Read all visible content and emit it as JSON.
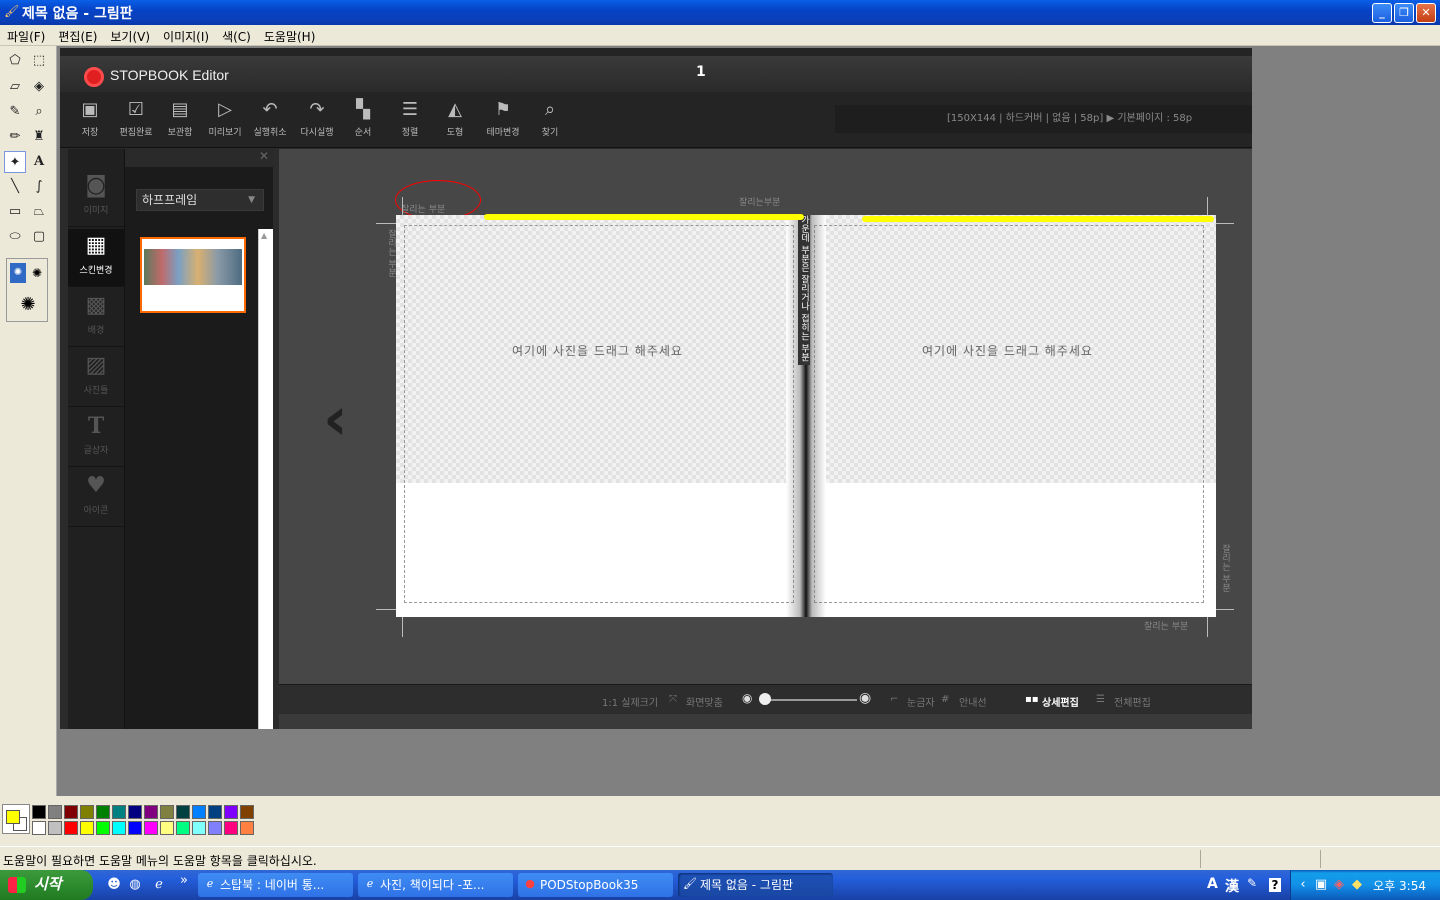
{
  "window": {
    "title": "제목 없음 - 그림판"
  },
  "menu": [
    "파일(F)",
    "편집(E)",
    "보기(V)",
    "이미지(I)",
    "색(C)",
    "도움말(H)"
  ],
  "editor": {
    "app_name": "STOPBOOK Editor",
    "page_number": "1",
    "toolbar": [
      {
        "label": "저장",
        "icon": "save-icon"
      },
      {
        "label": "편집완료",
        "icon": "check-doc-icon"
      },
      {
        "label": "보관함",
        "icon": "inbox-icon"
      },
      {
        "label": "미리보기",
        "icon": "play-icon"
      },
      {
        "label": "실행취소",
        "icon": "undo-icon"
      },
      {
        "label": "다시실행",
        "icon": "redo-icon"
      },
      {
        "label": "순서",
        "icon": "order-icon"
      },
      {
        "label": "정렬",
        "icon": "align-icon"
      },
      {
        "label": "도형",
        "icon": "shape-icon"
      },
      {
        "label": "테마변경",
        "icon": "bookmark-icon"
      },
      {
        "label": "찾기",
        "icon": "search-icon"
      }
    ],
    "book_info": "[150X144 | 하드커버 | 없음 | 58p]   ▶ 기본페이지 : 58p",
    "categories": [
      {
        "label": "이미지",
        "icon": "camera-icon",
        "active": false
      },
      {
        "label": "스킨변경",
        "icon": "skin-icon",
        "active": true
      },
      {
        "label": "배경",
        "icon": "grid-icon",
        "active": false
      },
      {
        "label": "사진틀",
        "icon": "picture-icon",
        "active": false
      },
      {
        "label": "글상자",
        "icon": "text-icon",
        "active": false
      },
      {
        "label": "아이콘",
        "icon": "heart-icon",
        "active": false
      }
    ],
    "frame_dropdown": "하프프레임",
    "drop_left": "여기에 사진을 드래그 해주세요",
    "drop_right": "여기에 사진을 드래그 해주세요",
    "cut_top_left": "잘리는 부분",
    "cut_top_center": "잘리는부분",
    "cut_bottom_right": "잘리는 부분",
    "cut_left_vertical": "잘리는 부분",
    "cut_right_vertical": "잘리는 부분",
    "spine_note": "가운데 부분은 잘리거나 접히는 부분이므로 중요한 내용은 피해주세요 바랍니다",
    "bottom_bar": {
      "actual_size": "1:1 실제크기",
      "fit_screen": "화면맞춤",
      "ruler": "눈금자",
      "guide": "안내선",
      "detail_edit": "상세편집",
      "full_edit": "전체편집"
    }
  },
  "palette": {
    "foreground": "#ffff00",
    "background": "#ffffff",
    "colors_row1": [
      "#000000",
      "#808080",
      "#800000",
      "#808000",
      "#008000",
      "#008080",
      "#000080",
      "#800080",
      "#808040",
      "#004040",
      "#0080ff",
      "#004080",
      "#8000ff",
      "#804000"
    ],
    "colors_row2": [
      "#ffffff",
      "#c0c0c0",
      "#ff0000",
      "#ffff00",
      "#00ff00",
      "#00ffff",
      "#0000ff",
      "#ff00ff",
      "#ffff80",
      "#00ff80",
      "#80ffff",
      "#8080ff",
      "#ff0080",
      "#ff8040"
    ]
  },
  "status": {
    "message": "도움말이 필요하면 도움말 메뉴의 도움말 항목을 클릭하십시오."
  },
  "taskbar": {
    "start": "시작",
    "tasks": [
      {
        "label": "스탑북 : 네이버 통...",
        "active": false
      },
      {
        "label": "사진, 책이되다 -포...",
        "active": false
      },
      {
        "label": "PODStopBook35",
        "active": false
      },
      {
        "label": "제목 없음 - 그림판",
        "active": true
      }
    ],
    "clock": "오후 3:54"
  }
}
